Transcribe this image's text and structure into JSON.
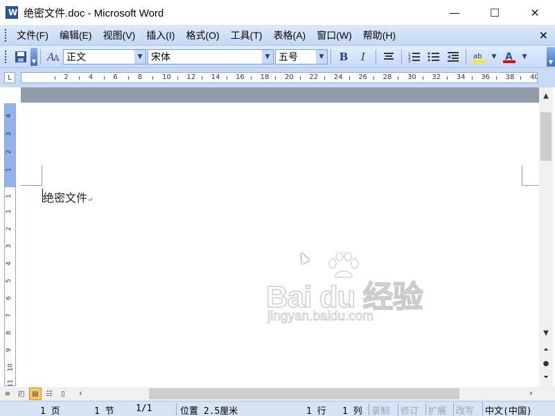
{
  "window": {
    "title": "绝密文件.doc - Microsoft Word",
    "minimize": "—",
    "maximize": "☐",
    "close": "✕"
  },
  "menu": {
    "items": [
      "文件(F)",
      "编辑(E)",
      "视图(V)",
      "插入(I)",
      "格式(O)",
      "工具(T)",
      "表格(A)",
      "窗口(W)",
      "帮助(H)"
    ],
    "close": "×"
  },
  "toolbar": {
    "style": "正文",
    "font": "宋体",
    "size": "五号",
    "bold": "B",
    "italic": "I"
  },
  "ruler": {
    "numbers": [
      "2",
      "4",
      "6",
      "8",
      "10",
      "12",
      "14",
      "16",
      "18",
      "20",
      "22",
      "24",
      "26",
      "28",
      "30",
      "32",
      "34",
      "36",
      "38",
      "40"
    ],
    "corner": "L"
  },
  "vertical_ruler": {
    "numbers": [
      "4",
      "3",
      "2",
      "1",
      "1",
      "1",
      "2",
      "3",
      "4",
      "5",
      "6",
      "7",
      "8",
      "9",
      "10",
      "11"
    ]
  },
  "document": {
    "text": "绝密文件",
    "para_mark": "↵"
  },
  "watermark": {
    "main": "Bai du 经验",
    "sub": "jingyan.baidu.com"
  },
  "statusbar": {
    "page": "1 页",
    "section": "1 节",
    "pages": "1/1",
    "position": "位置 2.5厘米",
    "line": "1 行",
    "column": "1 列",
    "rec": "录制",
    "trk": "修订",
    "ext": "扩展",
    "ovr": "改写",
    "lang": "中文(中国)"
  }
}
